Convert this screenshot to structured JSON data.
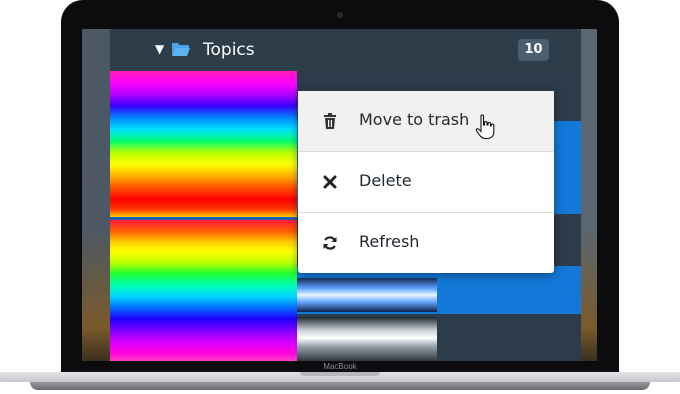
{
  "device": {
    "brand_label": "MacBook"
  },
  "header": {
    "title": "Topics",
    "count": "10"
  },
  "context_menu": {
    "items": [
      {
        "label": "Move to trash",
        "icon": "trash-icon"
      },
      {
        "label": "Delete",
        "icon": "close-icon"
      },
      {
        "label": "Refresh",
        "icon": "refresh-icon"
      }
    ]
  },
  "colors": {
    "accent": "#1378d8",
    "panel": "#2a3a48",
    "menu_bg": "#ffffff"
  }
}
